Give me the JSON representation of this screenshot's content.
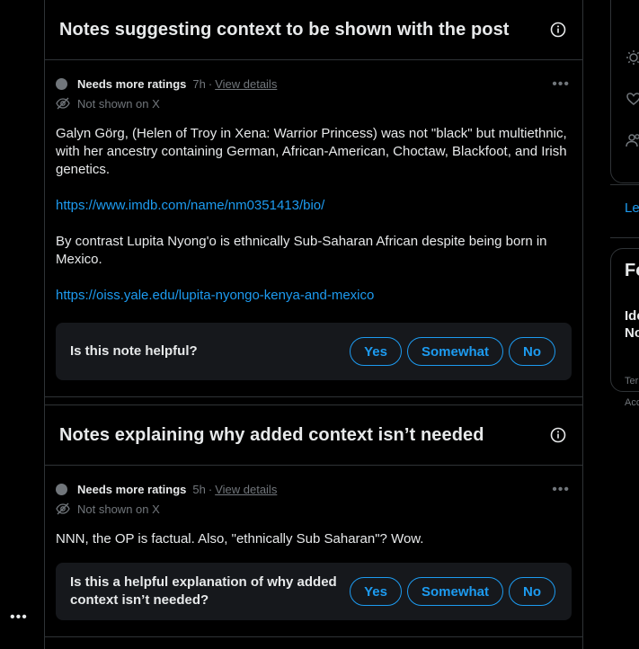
{
  "section1": {
    "title": "Notes suggesting context to be shown with the post",
    "note": {
      "status": "Needs more ratings",
      "time": "7h",
      "sep": "·",
      "details_link": "View details",
      "visibility": "Not shown on X",
      "paragraph1": "Galyn Görg, (Helen of Troy in Xena: Warrior Princess) was not \"black\" but multiethnic, with her ancestry containing German, African-American, Choctaw, Blackfoot, and Irish genetics.",
      "link1": "https://www.imdb.com/name/nm0351413/bio/",
      "paragraph2": "By contrast Lupita Nyong'o is ethnically Sub-Saharan African despite being born in Mexico.",
      "link2": "https://oiss.yale.edu/lupita-nyongo-kenya-and-mexico",
      "question": "Is this note helpful?",
      "yes": "Yes",
      "somewhat": "Somewhat",
      "no": "No"
    }
  },
  "section2": {
    "title": "Notes explaining why added context isn’t needed",
    "note": {
      "status": "Needs more ratings",
      "time": "5h",
      "sep": "·",
      "details_link": "View details",
      "visibility": "Not shown on X",
      "paragraph1": "NNN, the OP is factual. Also, \"ethnically Sub Saharan\"? Wow.",
      "question": "Is this a helpful explanation of why added context isn’t needed?",
      "yes": "Yes",
      "somewhat": "Somewhat",
      "no": "No"
    }
  },
  "right_sidebar": {
    "partial_link": "Le",
    "partial_heading": "Fo",
    "partial_line1": "Ide",
    "partial_line2": "No",
    "partial_footer1": "Ter",
    "partial_footer2": "Acc"
  },
  "left_sidebar": {
    "more": "•••"
  },
  "more_glyph": "•••",
  "colors": {
    "accent": "#1d9bf0",
    "muted": "#71767b",
    "background": "#000000",
    "card": "#16181c"
  }
}
